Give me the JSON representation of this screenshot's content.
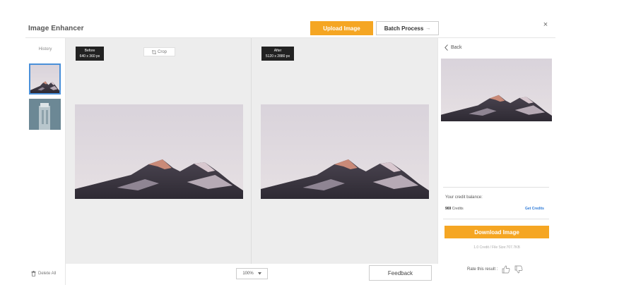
{
  "header": {
    "app_title": "Image Enhancer",
    "upload_label": "Upload Image",
    "batch_label": "Batch Process",
    "batch_arrow": "→",
    "close_glyph": "×"
  },
  "sidebar": {
    "history_label": "History",
    "delete_label": "Delete All"
  },
  "canvas": {
    "before_label": "Before",
    "before_size": "640 x 360 px",
    "after_label": "After",
    "after_size": "5120 x 2880 px",
    "crop_label": "Crop"
  },
  "footer": {
    "zoom_value": "100%",
    "feedback_label": "Feedback"
  },
  "panel": {
    "back_label": "Back",
    "credit_label": "Your credit balance:",
    "credit_count": "969",
    "credit_unit": "Credits",
    "get_credits_label": "Get Credits",
    "download_label": "Download Image",
    "file_info": "1.0 Credit / File Size:707.7KB",
    "rate_label": "Rate this result :"
  },
  "colors": {
    "accent": "#f5a623",
    "link": "#2f7bd8",
    "selection": "#4a90d9"
  }
}
